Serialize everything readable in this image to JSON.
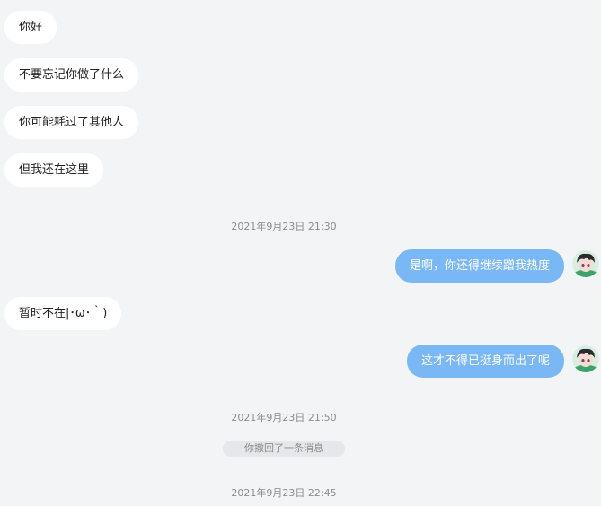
{
  "messages": {
    "m1": "你好",
    "m2": "不要忘记你做了什么",
    "m3": "你可能耗过了其他人",
    "m4": "但我还在这里",
    "m5": "是啊，你还得继续蹭我热度",
    "m6": "暂时不在|･ω･｀)",
    "m7": "这才不得已挺身而出了呢"
  },
  "timestamps": {
    "t1": "2021年9月23日 21:30",
    "t2": "2021年9月23日 21:50",
    "t3": "2021年9月23日 22:45"
  },
  "notice": "你撤回了一条消息",
  "colors": {
    "background": "#f3f4f6",
    "incoming_bubble": "#ffffff",
    "outgoing_bubble": "#7ab8f5"
  }
}
